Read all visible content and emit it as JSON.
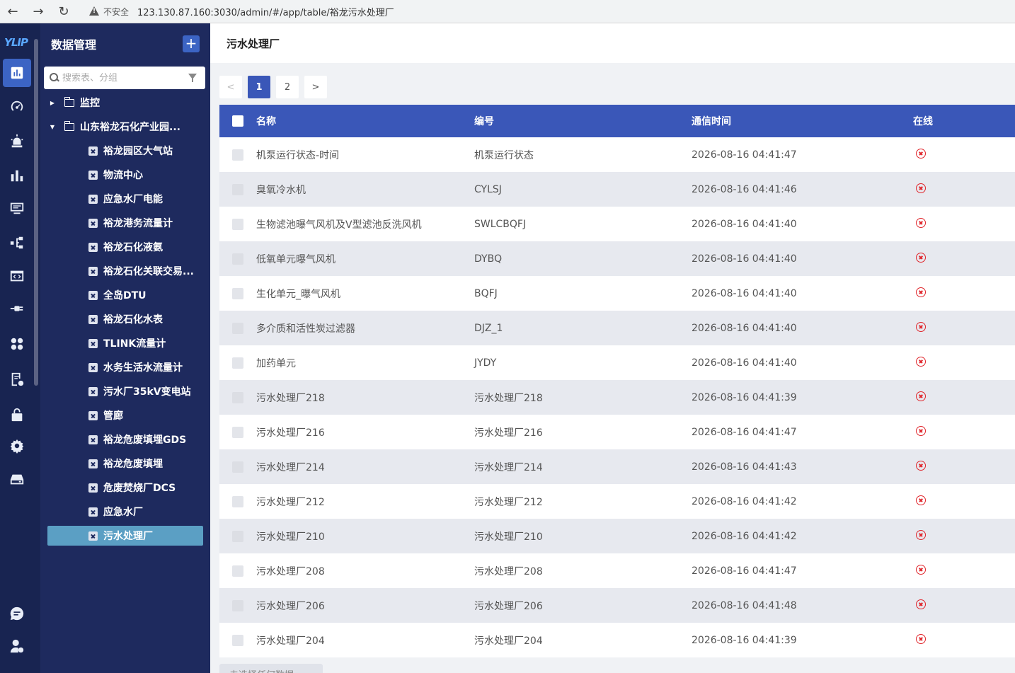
{
  "browser": {
    "insecure_label": "不安全",
    "url": "123.130.87.160:3030/admin/#/app/table/裕龙污水处理厂"
  },
  "rail": {
    "logo": "YLIP"
  },
  "sidebar": {
    "title": "数据管理",
    "add_label": "+",
    "search_placeholder": "搜索表、分组",
    "groups": [
      {
        "label": "监控",
        "expanded": false
      },
      {
        "label": "山东裕龙石化产业园...",
        "expanded": true
      }
    ],
    "items": [
      "裕龙园区大气站",
      "物流中心",
      "应急水厂电能",
      "裕龙港务流量计",
      "裕龙石化液氨",
      "裕龙石化关联交易...",
      "全岛DTU",
      "裕龙石化水表",
      "TLINK流量计",
      "水务生活水流量计",
      "污水厂35kV变电站",
      "管廊",
      "裕龙危废填埋GDS",
      "裕龙危废填埋",
      "危废焚烧厂DCS",
      "应急水厂",
      "污水处理厂"
    ],
    "selected": "污水处理厂"
  },
  "main": {
    "title": "污水处理厂",
    "pager": {
      "prev": "<",
      "pages": [
        "1",
        "2"
      ],
      "current": "1",
      "next": ">"
    },
    "columns": [
      "名称",
      "编号",
      "通信时间",
      "在线"
    ],
    "rows": [
      {
        "name": "机泵运行状态-时间",
        "code": "机泵运行状态",
        "time": "2026-08-16 04:41:47",
        "online": false
      },
      {
        "name": "臭氧冷水机",
        "code": "CYLSJ",
        "time": "2026-08-16 04:41:46",
        "online": false
      },
      {
        "name": "生物滤池曝气风机及V型滤池反洗风机",
        "code": "SWLCBQFJ",
        "time": "2026-08-16 04:41:40",
        "online": false
      },
      {
        "name": "低氧单元曝气风机",
        "code": "DYBQ",
        "time": "2026-08-16 04:41:40",
        "online": false
      },
      {
        "name": "生化单元_曝气风机",
        "code": "BQFJ",
        "time": "2026-08-16 04:41:40",
        "online": false
      },
      {
        "name": "多介质和活性炭过滤器",
        "code": "DJZ_1",
        "time": "2026-08-16 04:41:40",
        "online": false
      },
      {
        "name": "加药单元",
        "code": "JYDY",
        "time": "2026-08-16 04:41:40",
        "online": false
      },
      {
        "name": "污水处理厂218",
        "code": "污水处理厂218",
        "time": "2026-08-16 04:41:39",
        "online": false
      },
      {
        "name": "污水处理厂216",
        "code": "污水处理厂216",
        "time": "2026-08-16 04:41:47",
        "online": false
      },
      {
        "name": "污水处理厂214",
        "code": "污水处理厂214",
        "time": "2026-08-16 04:41:43",
        "online": false
      },
      {
        "name": "污水处理厂212",
        "code": "污水处理厂212",
        "time": "2026-08-16 04:41:42",
        "online": false
      },
      {
        "name": "污水处理厂210",
        "code": "污水处理厂210",
        "time": "2026-08-16 04:41:42",
        "online": false
      },
      {
        "name": "污水处理厂208",
        "code": "污水处理厂208",
        "time": "2026-08-16 04:41:47",
        "online": false
      },
      {
        "name": "污水处理厂206",
        "code": "污水处理厂206",
        "time": "2026-08-16 04:41:48",
        "online": false
      },
      {
        "name": "污水处理厂204",
        "code": "污水处理厂204",
        "time": "2026-08-16 04:41:39",
        "online": false
      }
    ],
    "bottom_button": "未选择任何数据"
  }
}
